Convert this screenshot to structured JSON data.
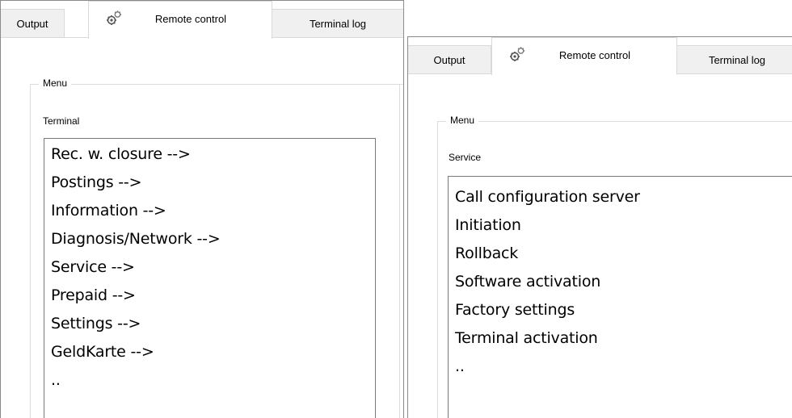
{
  "left_panel": {
    "tabs": [
      "Output",
      "Remote control",
      "Terminal log"
    ],
    "active_tab": "Remote control",
    "group_title": "Menu",
    "section_label": "Terminal",
    "items": [
      "Rec. w. closure  -->",
      "Postings  -->",
      "Information  -->",
      "Diagnosis/Network  -->",
      "Service  -->",
      "Prepaid  -->",
      "Settings  -->",
      "GeldKarte  -->",
      ".."
    ]
  },
  "right_panel": {
    "tabs": [
      "Output",
      "Remote control",
      "Terminal log"
    ],
    "active_tab": "Remote control",
    "group_title": "Menu",
    "section_label": "Service",
    "items": [
      "Call configuration server",
      "Initiation",
      "Rollback",
      "Software activation",
      "Factory settings",
      "Terminal activation",
      ".."
    ]
  },
  "icons": {
    "remote_control_tab": "gears-icon"
  }
}
